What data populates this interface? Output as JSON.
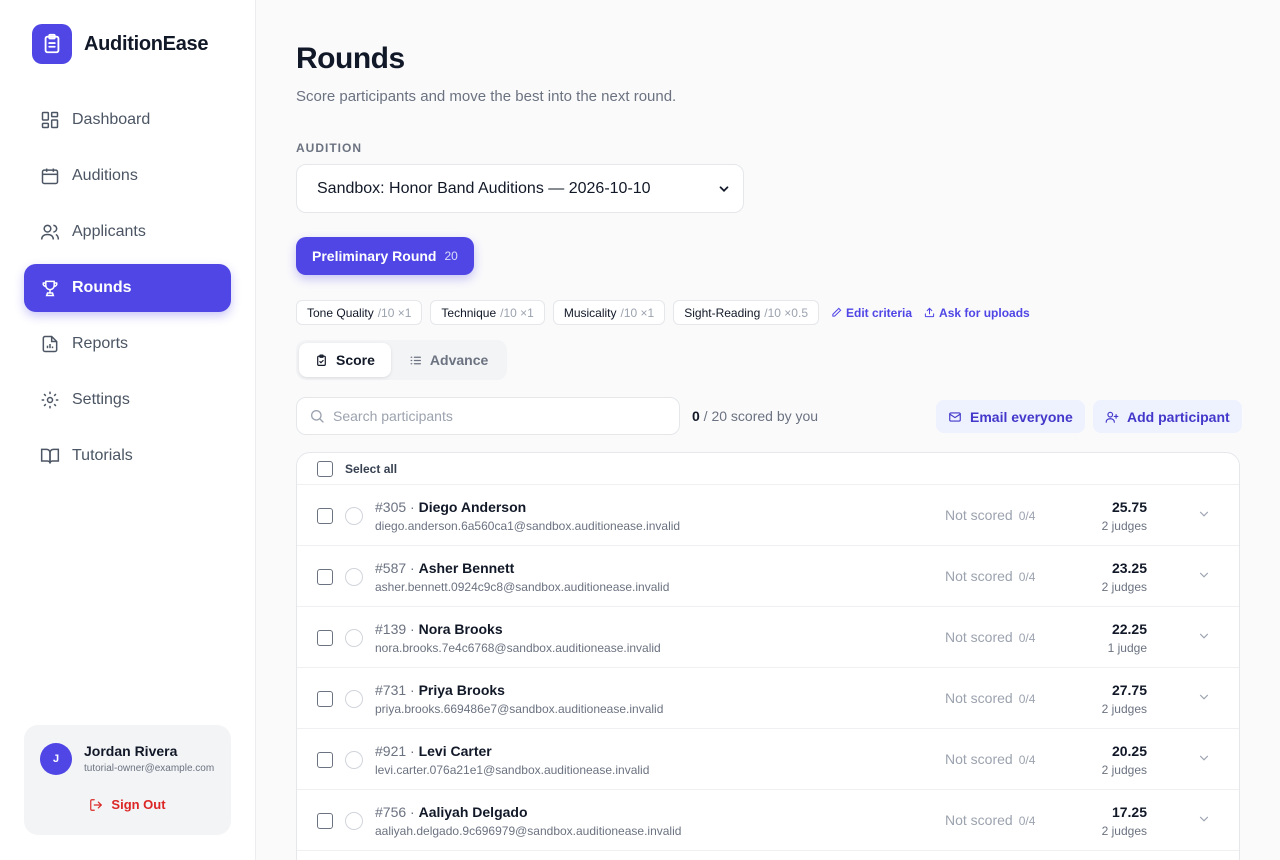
{
  "app": {
    "name": "AuditionEase"
  },
  "sidebar": {
    "items": [
      {
        "label": "Dashboard",
        "icon": "dashboard-icon"
      },
      {
        "label": "Auditions",
        "icon": "calendar-icon"
      },
      {
        "label": "Applicants",
        "icon": "users-icon"
      },
      {
        "label": "Rounds",
        "icon": "trophy-icon",
        "active": true
      },
      {
        "label": "Reports",
        "icon": "report-icon"
      },
      {
        "label": "Settings",
        "icon": "gear-icon"
      },
      {
        "label": "Tutorials",
        "icon": "book-icon"
      }
    ]
  },
  "user": {
    "initial": "J",
    "name": "Jordan Rivera",
    "email": "tutorial-owner@example.com",
    "signout_label": "Sign Out"
  },
  "page": {
    "title": "Rounds",
    "subtitle": "Score participants and move the best into the next round."
  },
  "audition": {
    "label": "AUDITION",
    "selected": "Sandbox: Honor Band Auditions — 2026-10-10"
  },
  "round": {
    "name": "Preliminary Round",
    "count": "20"
  },
  "criteria": [
    {
      "name": "Tone Quality",
      "meta": "/10 ×1"
    },
    {
      "name": "Technique",
      "meta": "/10 ×1"
    },
    {
      "name": "Musicality",
      "meta": "/10 ×1"
    },
    {
      "name": "Sight-Reading",
      "meta": "/10 ×0.5"
    }
  ],
  "links": {
    "edit_criteria": "Edit criteria",
    "ask_uploads": "Ask for uploads"
  },
  "tabs": {
    "score": "Score",
    "advance": "Advance"
  },
  "search": {
    "placeholder": "Search participants"
  },
  "progress": {
    "scored": "0",
    "rest": " / 20 scored by you"
  },
  "actions": {
    "email_everyone": "Email everyone",
    "add_participant": "Add participant"
  },
  "table": {
    "select_all": "Select all",
    "rows": [
      {
        "number": "#305 · ",
        "name": "Diego Anderson",
        "email": "diego.anderson.6a560ca1@sandbox.auditionease.invalid",
        "status": "Not scored",
        "progress": "0/4",
        "score": "25.75",
        "judges": "2 judges"
      },
      {
        "number": "#587 · ",
        "name": "Asher Bennett",
        "email": "asher.bennett.0924c9c8@sandbox.auditionease.invalid",
        "status": "Not scored",
        "progress": "0/4",
        "score": "23.25",
        "judges": "2 judges"
      },
      {
        "number": "#139 · ",
        "name": "Nora Brooks",
        "email": "nora.brooks.7e4c6768@sandbox.auditionease.invalid",
        "status": "Not scored",
        "progress": "0/4",
        "score": "22.25",
        "judges": "1 judge"
      },
      {
        "number": "#731 · ",
        "name": "Priya Brooks",
        "email": "priya.brooks.669486e7@sandbox.auditionease.invalid",
        "status": "Not scored",
        "progress": "0/4",
        "score": "27.75",
        "judges": "2 judges"
      },
      {
        "number": "#921 · ",
        "name": "Levi Carter",
        "email": "levi.carter.076a21e1@sandbox.auditionease.invalid",
        "status": "Not scored",
        "progress": "0/4",
        "score": "20.25",
        "judges": "2 judges"
      },
      {
        "number": "#756 · ",
        "name": "Aaliyah Delgado",
        "email": "aaliyah.delgado.9c696979@sandbox.auditionease.invalid",
        "status": "Not scored",
        "progress": "0/4",
        "score": "17.25",
        "judges": "2 judges"
      }
    ]
  },
  "colors": {
    "accent": "#4f46e5",
    "danger": "#dc2626",
    "muted": "#6b7280"
  }
}
